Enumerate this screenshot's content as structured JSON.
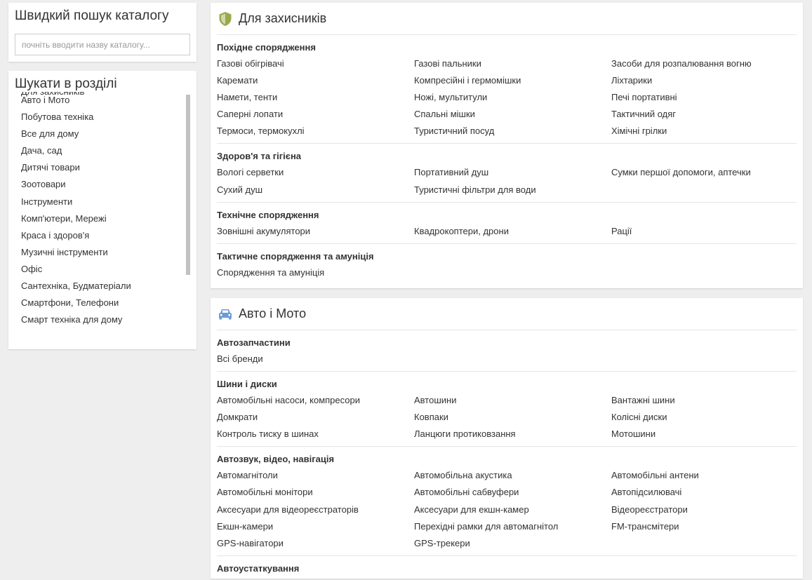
{
  "quick_search": {
    "title": "Швидкий пошук каталогу",
    "placeholder": "почніть вводити назву каталогу..."
  },
  "section_search": {
    "title": "Шукати в розділі",
    "items": [
      "Для захисників",
      "Авто і Мото",
      "Побутова техніка",
      "Все для дому",
      "Дача, сад",
      "Дитячі товари",
      "Зоотовари",
      "Інструменти",
      "Комп'ютери, Мережі",
      "Краса і здоров'я",
      "Музичні інструменти",
      "Офіс",
      "Сантехніка, Будматеріали",
      "Смартфони, Телефони",
      "Смарт техніка для дому"
    ]
  },
  "categories": [
    {
      "title": "Для захисників",
      "icon": "shield-icon",
      "icon_color": "#9ba84c",
      "groups": [
        {
          "title": "Похідне спорядження",
          "links": [
            "Газові обігрівачі",
            "Газові пальники",
            "Засоби для розпалювання вогню",
            "Каремати",
            "Компресійні і гермомішки",
            "Ліхтарики",
            "Намети, тенти",
            "Ножі, мультитули",
            "Печі портативні",
            "Саперні лопати",
            "Спальні мішки",
            "Тактичний одяг",
            "Термоси, термокухлі",
            "Туристичний посуд",
            "Хімічні грілки"
          ]
        },
        {
          "title": "Здоров'я та гігієна",
          "links": [
            "Вологі серветки",
            "Портативний душ",
            "Сумки першої допомоги, аптечки",
            "Сухий душ",
            "Туристичні фільтри для води"
          ]
        },
        {
          "title": "Технічне спорядження",
          "links": [
            "Зовнішні акумулятори",
            "Квадрокоптери, дрони",
            "Рації"
          ]
        },
        {
          "title": "Тактичне спорядження та амуніція",
          "links": [
            "Спорядження та амуніція"
          ]
        }
      ]
    },
    {
      "title": "Авто і Мото",
      "icon": "car-icon",
      "icon_color": "#6a9bd8",
      "groups": [
        {
          "title": "Автозапчастини",
          "links": [
            "Всі бренди"
          ]
        },
        {
          "title": "Шини і диски",
          "links": [
            "Автомобільні насоси, компресори",
            "Автошини",
            "Вантажні шини",
            "Домкрати",
            "Ковпаки",
            "Колісні диски",
            "Контроль тиску в шинах",
            "Ланцюги протиковзання",
            "Мотошини"
          ]
        },
        {
          "title": "Автозвук, відео, навігація",
          "links": [
            "Автомагнітоли",
            "Автомобільна акустика",
            "Автомобільні антени",
            "Автомобільні монітори",
            "Автомобільні сабвуфери",
            "Автопідсилювачі",
            "Аксесуари для відеореєстраторів",
            "Аксесуари для екшн-камер",
            "Відеореєстратори",
            "Екшн-камери",
            "Перехідні рамки для автомагнітол",
            "FM-трансмітери",
            "GPS-навігатори",
            "GPS-трекери"
          ]
        },
        {
          "title": "Автоустаткування",
          "links": []
        }
      ]
    }
  ]
}
